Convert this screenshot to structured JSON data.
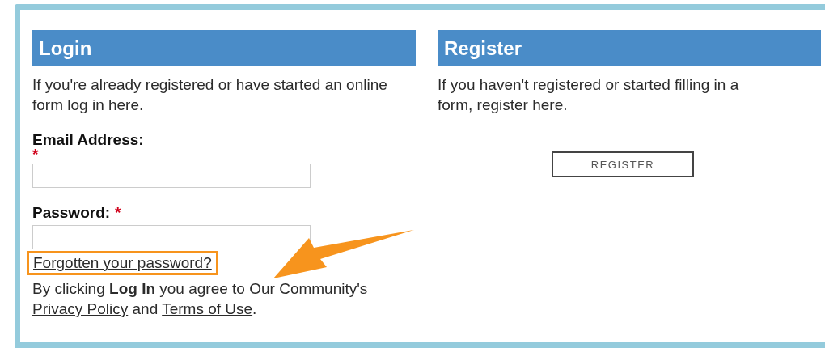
{
  "login": {
    "title": "Login",
    "intro": "If you're already registered or have started an online form log in here.",
    "fields": [
      {
        "label": "Email Address:",
        "required_mark": "*",
        "kind": "stacked"
      },
      {
        "label": "Password:",
        "required_mark": "*",
        "kind": "inline"
      }
    ],
    "forgot_link": {
      "text": "Forgotten your password?",
      "highlighted": true
    },
    "terms": {
      "before": "By clicking **Log In** you agree to Our Community's",
      "privacy_link": "Privacy Policy",
      "middle": "and",
      "terms_link": "Terms of Use",
      "after": "."
    }
  },
  "register": {
    "title": "Register",
    "intro": "If you haven't registered or started filling in a form, register here.",
    "button": "REGISTER"
  }
}
